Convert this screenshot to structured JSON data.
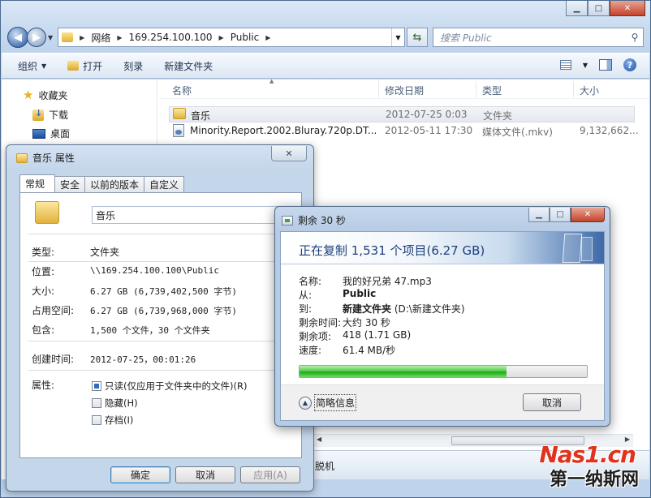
{
  "explorer": {
    "breadcrumb": [
      "网络",
      "169.254.100.100",
      "Public"
    ],
    "search_placeholder": "搜索 Public",
    "toolbar": {
      "organize": "组织",
      "open": "打开",
      "burn": "刻录",
      "new_folder": "新建文件夹"
    },
    "nav": {
      "favorites": "收藏夹",
      "downloads": "下载",
      "desktop": "桌面"
    },
    "columns": {
      "name": "名称",
      "modified": "修改日期",
      "type": "类型",
      "size": "大小"
    },
    "files": [
      {
        "name": "音乐",
        "modified": "2012-07-25 0:03",
        "type": "文件夹",
        "size": ""
      },
      {
        "name": "Minority.Report.2002.Bluray.720p.DT...",
        "modified": "2012-05-11 17:30",
        "type": "媒体文件(.mkv)",
        "size": "9,132,662..."
      }
    ],
    "details_text": "脱机"
  },
  "properties": {
    "title": "音乐 属性",
    "tabs": [
      "常规",
      "安全",
      "以前的版本",
      "自定义"
    ],
    "folder_name": "音乐",
    "labels": {
      "type": "类型:",
      "location": "位置:",
      "size": "大小:",
      "size_on_disk": "占用空间:",
      "contains": "包含:",
      "created": "创建时间:",
      "attributes": "属性:"
    },
    "values": {
      "type": "文件夹",
      "location": "\\\\169.254.100.100\\Public",
      "size": "6.27 GB (6,739,402,500 字节)",
      "size_on_disk": "6.27 GB (6,739,968,000 字节)",
      "contains": "1,500 个文件，30 个文件夹",
      "created": "2012-07-25，00:01:26"
    },
    "attributes": [
      {
        "label": "只读(仅应用于文件夹中的文件)(R)",
        "checked": true
      },
      {
        "label": "隐藏(H)",
        "checked": false
      },
      {
        "label": "存档(I)",
        "checked": false
      }
    ],
    "buttons": {
      "ok": "确定",
      "cancel": "取消",
      "apply": "应用(A)"
    }
  },
  "copy_dialog": {
    "title": "剩余 30 秒",
    "headline": "正在复制 1,531 个项目(6.27 GB)",
    "labels": {
      "name": "名称:",
      "from": "从:",
      "to": "到:",
      "time_left": "剩余时间:",
      "items_left": "剩余项:",
      "speed": "速度:"
    },
    "values": {
      "name": "我的好兄弟 47.mp3",
      "from": "Public",
      "to_bold": "新建文件夹",
      "to_rest": " (D:\\新建文件夹)",
      "time_left": "大约 30 秒",
      "items_left": "418 (1.71 GB)",
      "speed": "61.4 MB/秒"
    },
    "progress": 0.72,
    "less_info": "简略信息",
    "cancel": "取消"
  },
  "watermark": {
    "line1": "Nas1.cn",
    "line2": "第一纳斯网"
  }
}
